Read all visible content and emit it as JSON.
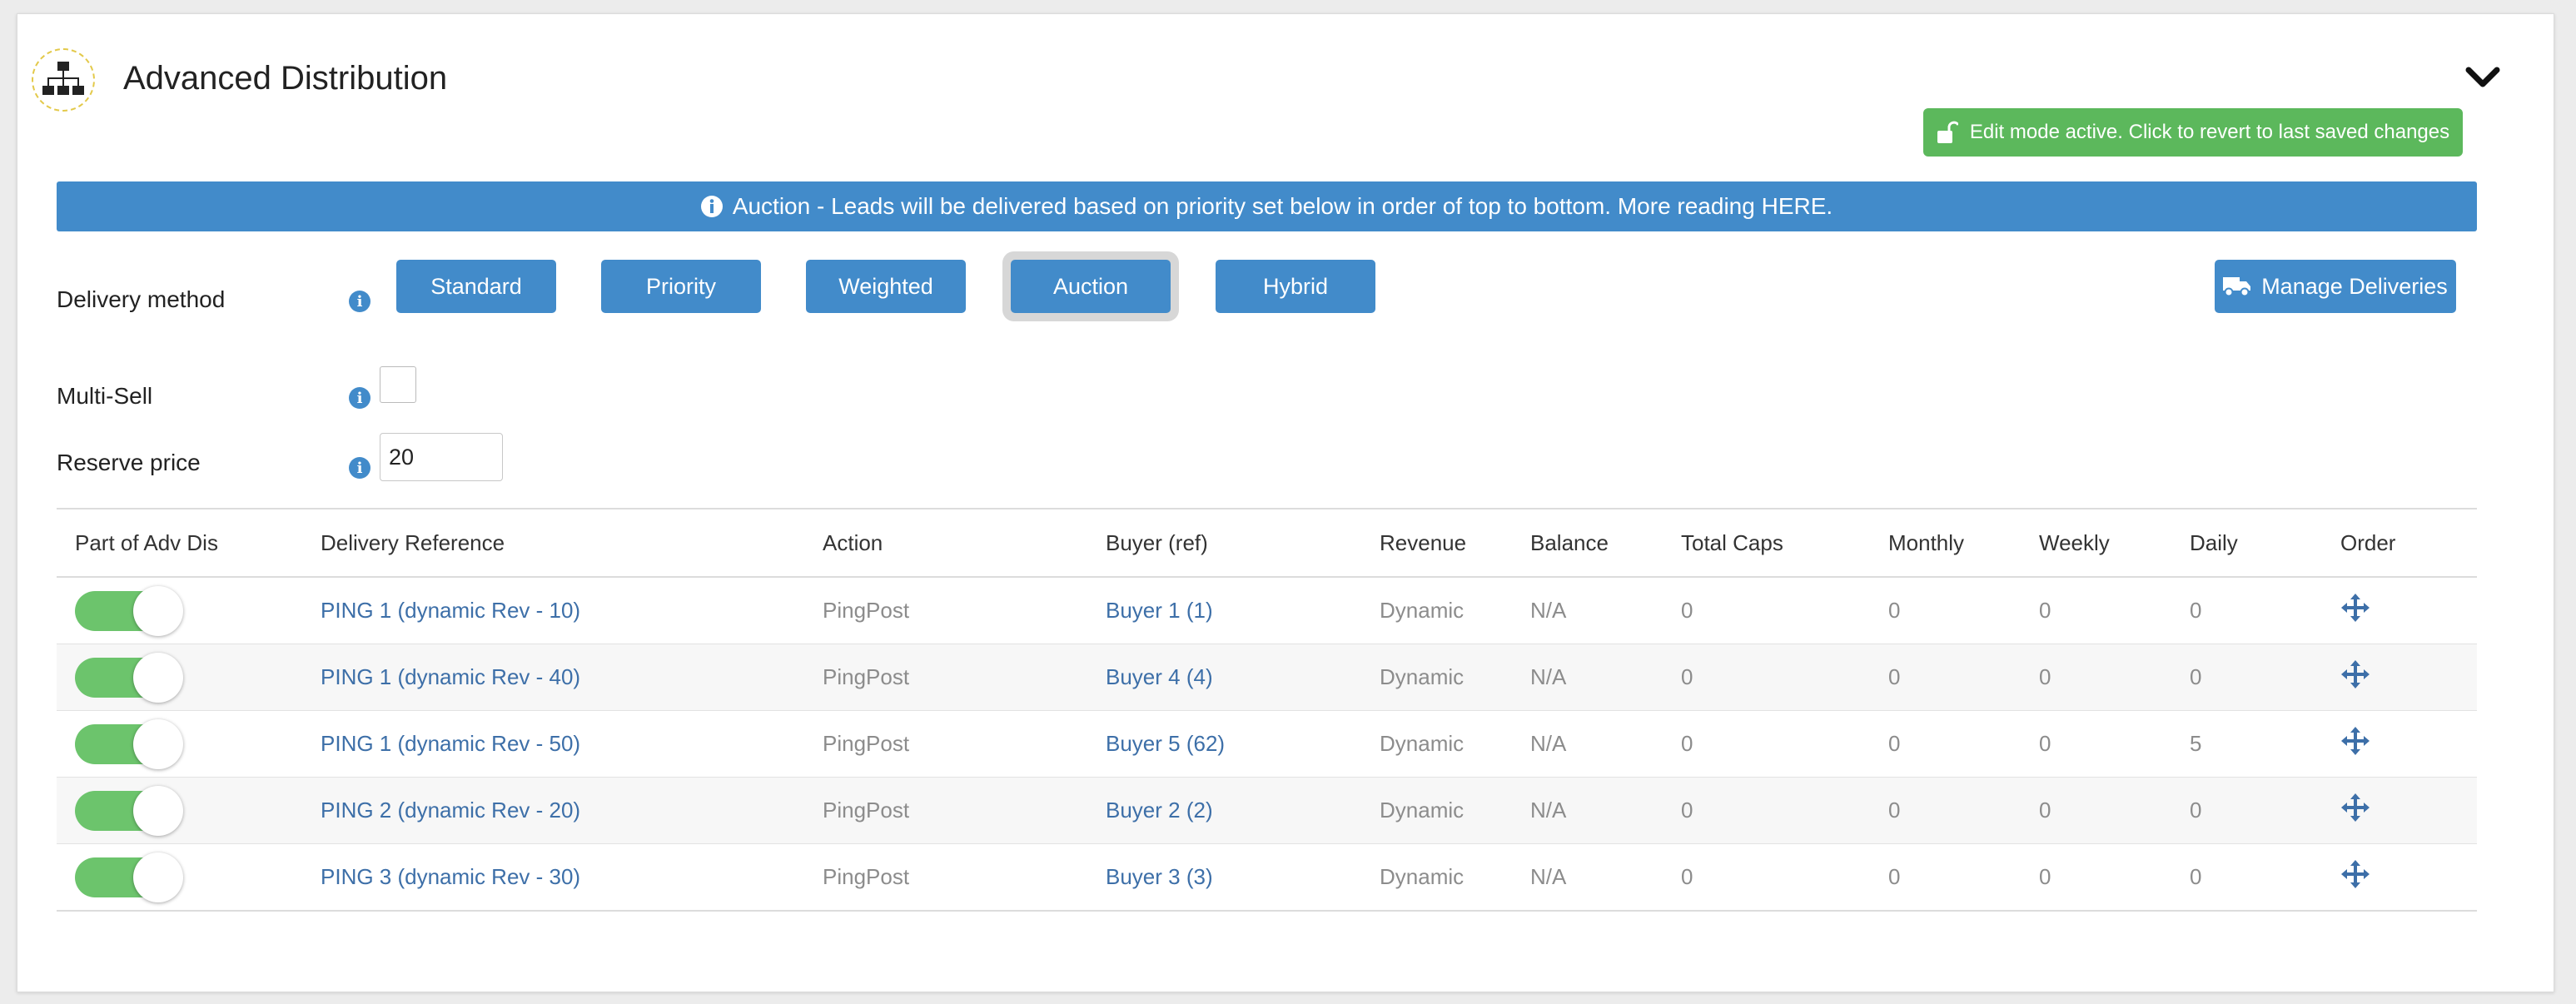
{
  "header": {
    "title": "Advanced Distribution",
    "edit_mode_label": "Edit mode active. Click to revert to last saved changes"
  },
  "banner": {
    "text": "Auction - Leads will be delivered based on priority set below in order of top to bottom. More reading HERE."
  },
  "delivery_method": {
    "label": "Delivery method",
    "options": [
      "Standard",
      "Priority",
      "Weighted",
      "Auction",
      "Hybrid"
    ],
    "selected": "Auction",
    "manage_label": "Manage Deliveries"
  },
  "multi_sell": {
    "label": "Multi-Sell",
    "checked": false
  },
  "reserve_price": {
    "label": "Reserve price",
    "value": "20"
  },
  "table": {
    "columns": [
      "Part of Adv Dis",
      "Delivery Reference",
      "Action",
      "Buyer (ref)",
      "Revenue",
      "Balance",
      "Total Caps",
      "Monthly",
      "Weekly",
      "Daily",
      "Order"
    ],
    "rows": [
      {
        "enabled": true,
        "reference": "PING 1 (dynamic Rev - 10)",
        "action": "PingPost",
        "buyer": "Buyer 1 (1)",
        "revenue": "Dynamic",
        "balance": "N/A",
        "total_caps": "0",
        "monthly": "0",
        "weekly": "0",
        "daily": "0"
      },
      {
        "enabled": true,
        "reference": "PING 1 (dynamic Rev - 40)",
        "action": "PingPost",
        "buyer": "Buyer 4 (4)",
        "revenue": "Dynamic",
        "balance": "N/A",
        "total_caps": "0",
        "monthly": "0",
        "weekly": "0",
        "daily": "0"
      },
      {
        "enabled": true,
        "reference": "PING 1 (dynamic Rev - 50)",
        "action": "PingPost",
        "buyer": "Buyer 5 (62)",
        "revenue": "Dynamic",
        "balance": "N/A",
        "total_caps": "0",
        "monthly": "0",
        "weekly": "0",
        "daily": "5"
      },
      {
        "enabled": true,
        "reference": "PING 2 (dynamic Rev - 20)",
        "action": "PingPost",
        "buyer": "Buyer 2 (2)",
        "revenue": "Dynamic",
        "balance": "N/A",
        "total_caps": "0",
        "monthly": "0",
        "weekly": "0",
        "daily": "0"
      },
      {
        "enabled": true,
        "reference": "PING 3 (dynamic Rev - 30)",
        "action": "PingPost",
        "buyer": "Buyer 3 (3)",
        "revenue": "Dynamic",
        "balance": "N/A",
        "total_caps": "0",
        "monthly": "0",
        "weekly": "0",
        "daily": "0"
      }
    ]
  },
  "icons": {
    "header": "sitemap-icon",
    "collapse": "chevron-down-icon",
    "edit": "unlock-icon",
    "banner": "info-icon",
    "manage": "truck-icon",
    "order": "move-icon"
  },
  "colors": {
    "primary": "#428bca",
    "success": "#5cb85c",
    "toggle_on": "#6cc46c",
    "link": "#3d6fa8"
  }
}
